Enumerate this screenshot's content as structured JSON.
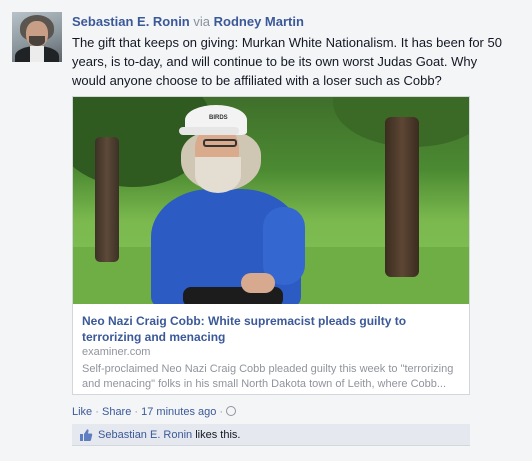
{
  "post": {
    "author": "Sebastian E. Ronin",
    "via_label": "via",
    "via_author": "Rodney Martin",
    "message": "The gift that keeps on giving: Murkan White Nationalism. It has been for 50 years, is to-day, and will continue to be its own worst Judas Goat. Why would anyone choose to be affiliated with a loser such as Cobb?"
  },
  "attachment": {
    "cap_text": "BIRDS",
    "title": "Neo Nazi Craig Cobb: White supremacist pleads guilty to terrorizing and menacing",
    "domain": "examiner.com",
    "description": "Self-proclaimed Neo Nazi Craig Cobb pleaded guilty this week to \"terrorizing and menacing\" folks in his small North Dakota town of Leith, where Cobb..."
  },
  "actions": {
    "like": "Like",
    "share": "Share",
    "separator": "·",
    "time": "17 minutes ago"
  },
  "likes": {
    "name": "Sebastian E. Ronin",
    "suffix": "likes this."
  },
  "colors": {
    "link": "#3b5998",
    "meta": "#90949c",
    "background": "#f4f5f7"
  }
}
